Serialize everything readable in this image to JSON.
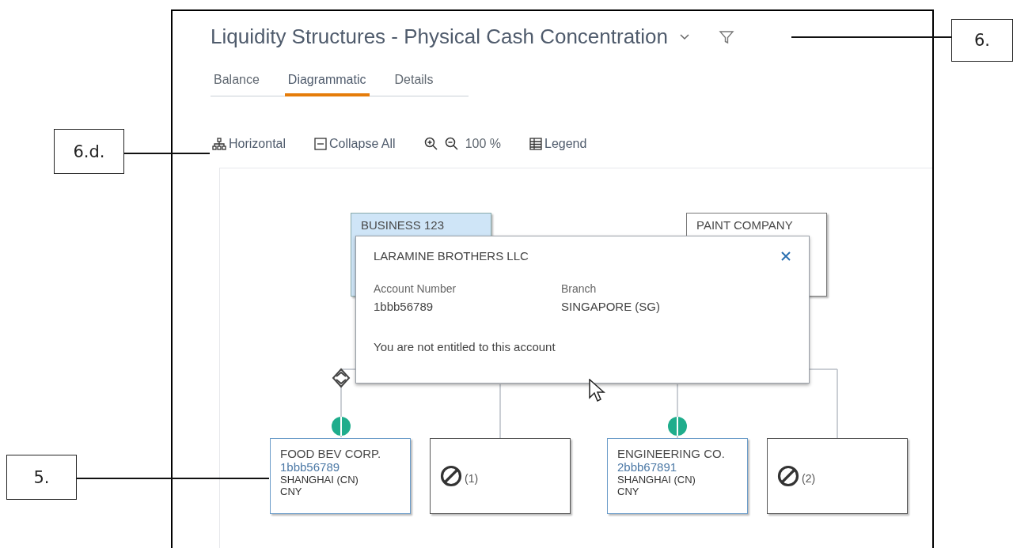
{
  "header": {
    "title": "Liquidity Structures - Physical Cash Concentration"
  },
  "tabs": [
    {
      "label": "Balance",
      "selected": false
    },
    {
      "label": "Diagrammatic",
      "selected": true
    },
    {
      "label": "Details",
      "selected": false
    }
  ],
  "toolbar": [
    {
      "kind": "layout",
      "label": "Horizontal"
    },
    {
      "kind": "collapse",
      "label": "Collapse All"
    },
    {
      "kind": "zoom_in"
    },
    {
      "kind": "zoom_out"
    },
    {
      "kind": "zoom_level",
      "label": "100 %"
    },
    {
      "kind": "legend",
      "label": "Legend"
    }
  ],
  "diagram": {
    "top_nodes": [
      {
        "name": "BUSINESS 123",
        "highlighted": true
      },
      {
        "name": "PAINT COMPANY",
        "highlighted": false
      }
    ],
    "popup": {
      "title": "LARAMINE BROTHERS LLC",
      "fields": [
        {
          "label": "Account Number",
          "value": "1bbb56789"
        },
        {
          "label": "Branch",
          "value": "SINGAPORE (SG)"
        }
      ],
      "message": "You are not entitled to this account"
    },
    "bottom_nodes": [
      {
        "kind": "account",
        "name": "FOOD BEV CORP.",
        "account": "1bbb56789",
        "branch": "SHANGHAI (CN)",
        "currency": "CNY"
      },
      {
        "kind": "restricted",
        "count": "(1)"
      },
      {
        "kind": "account",
        "name": "ENGINEERING CO.",
        "account": "2bbb67891",
        "branch": "SHANGHAI (CN)",
        "currency": "CNY"
      },
      {
        "kind": "restricted",
        "count": "(2)"
      }
    ]
  },
  "callouts": [
    {
      "label": "6."
    },
    {
      "label": "6.d."
    },
    {
      "label": "5."
    }
  ]
}
